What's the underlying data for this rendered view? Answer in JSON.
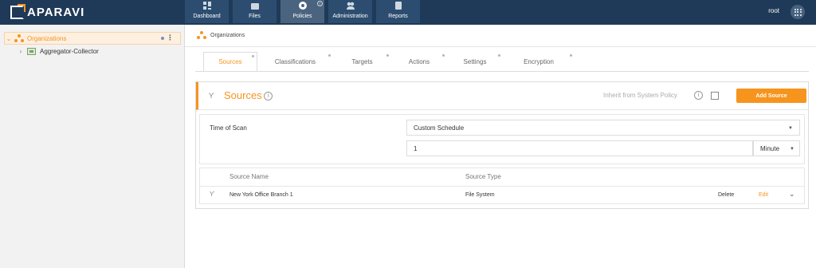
{
  "app": {
    "logo_text": "APARAVI"
  },
  "nav": {
    "items": [
      {
        "label": "Dashboard",
        "icon": "dashboard-icon"
      },
      {
        "label": "Files",
        "icon": "folder-icon"
      },
      {
        "label": "Policies",
        "icon": "gear-icon",
        "active": true
      },
      {
        "label": "Administration",
        "icon": "users-icon"
      },
      {
        "label": "Reports",
        "icon": "report-icon"
      }
    ],
    "user": "root",
    "apps_icon": "apps-grid-icon"
  },
  "sidebar": {
    "root": {
      "label": "Organizations",
      "icon": "organization-icon",
      "expanded": true
    },
    "child": {
      "label": "Aggregator-Collector",
      "icon": "aggregator-icon"
    }
  },
  "breadcrumb": {
    "label": "Organizations"
  },
  "tabs": [
    {
      "label": "Sources",
      "active": true
    },
    {
      "label": "Classifications"
    },
    {
      "label": "Targets"
    },
    {
      "label": "Actions"
    },
    {
      "label": "Settings"
    },
    {
      "label": "Encryption"
    }
  ],
  "panel": {
    "title": "Sources",
    "inherit_label": "Inherit from System Policy",
    "inherit_checked": false,
    "add_button": "Add Source"
  },
  "schedule": {
    "label": "Time of Scan",
    "schedule_value": "Custom Schedule",
    "interval_value": "1",
    "unit_value": "Minute"
  },
  "table": {
    "headers": {
      "name": "Source Name",
      "type": "Source Type"
    },
    "rows": [
      {
        "name": "New York Office Branch 1",
        "type": "File System",
        "delete": "Delete",
        "edit": "Edit"
      }
    ]
  },
  "colors": {
    "accent": "#f7941d",
    "header_bg": "#1f3a58"
  }
}
